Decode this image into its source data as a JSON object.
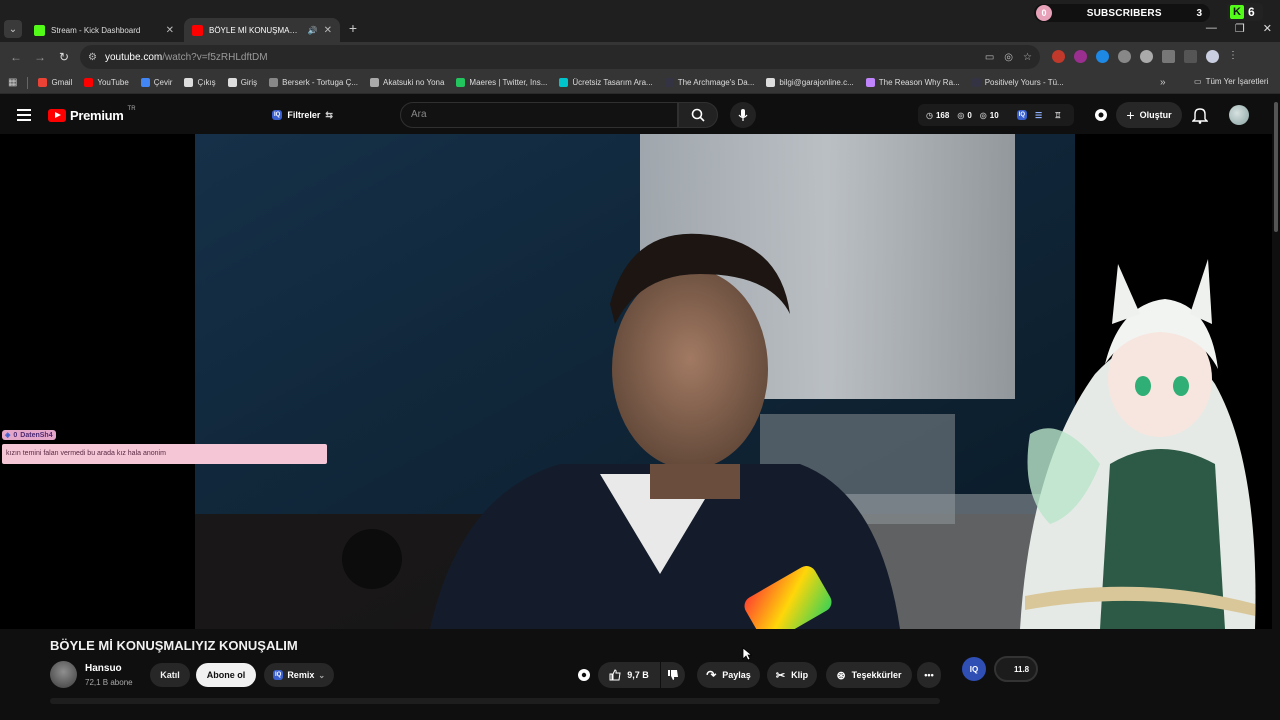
{
  "browser": {
    "tabs": [
      {
        "title": "Stream - Kick Dashboard",
        "active": false,
        "favicon_color": "#53fc18"
      },
      {
        "title": "BÖYLE Mİ KONUŞMALIYIZ KONUŞALIM",
        "active": true,
        "favicon_color": "#ff0000"
      }
    ],
    "url": {
      "host": "youtube.com",
      "path": "/watch?v=f5zRHLdftDM"
    },
    "bookmarks": [
      {
        "label": "Gmail",
        "color": "#ea4335"
      },
      {
        "label": "YouTube",
        "color": "#ff0000"
      },
      {
        "label": "Çevir",
        "color": "#4285f4"
      },
      {
        "label": "Çıkış",
        "color": "#dddddd"
      },
      {
        "label": "Giriş",
        "color": "#dddddd"
      },
      {
        "label": "Berserk - Tortuga Ç...",
        "color": "#888888"
      },
      {
        "label": "Akatsuki no Yona",
        "color": "#aaaaaa"
      },
      {
        "label": "Maeres | Twitter, Ins...",
        "color": "#22c55e"
      },
      {
        "label": "Ücretsiz Tasarım Ara...",
        "color": "#00c4cc"
      },
      {
        "label": "The Archmage's Da...",
        "color": "#333344"
      },
      {
        "label": "bilgi@garajonline.c...",
        "color": "#dddddd"
      },
      {
        "label": "The Reason Why Ra...",
        "color": "#c084fc"
      },
      {
        "label": "Positively Yours - Tü...",
        "color": "#333344"
      }
    ],
    "all_bookmarks_label": "Tüm Yer İşaretleri"
  },
  "stream_widgets": {
    "subscribers_label": "SUBSCRIBERS",
    "subscribers_badge": "0",
    "subscribers_count": "3",
    "kick_count": "6"
  },
  "youtube": {
    "logo_text": "Premium",
    "region": "TR",
    "filters_label": "Filtreler",
    "search_placeholder": "Ara",
    "stats": {
      "views": "168",
      "a": "0",
      "b": "10"
    },
    "create_label": "Oluştur"
  },
  "chat": {
    "username": "DatenSh4",
    "badge": "0",
    "message": "kızın temini falan vermedi bu arada kız hala anonim"
  },
  "video": {
    "title": "BÖYLE Mİ KONUŞMALIYIZ KONUŞALIM",
    "channel": "Hansuo",
    "subscribers": "72,1 B abone",
    "join_label": "Katıl",
    "subscribe_label": "Abone ol",
    "remix_label": "Remix",
    "likes": "9,7 B",
    "share_label": "Paylaş",
    "clip_label": "Klip",
    "thanks_label": "Teşekkürler",
    "iq_label": "IQ",
    "iq_value": "11.8"
  },
  "colors": {
    "accent_red": "#ff0000",
    "yt_bg": "#0f0f0f",
    "button_bg": "#272727",
    "chat_pink": "#f5c6d5"
  }
}
